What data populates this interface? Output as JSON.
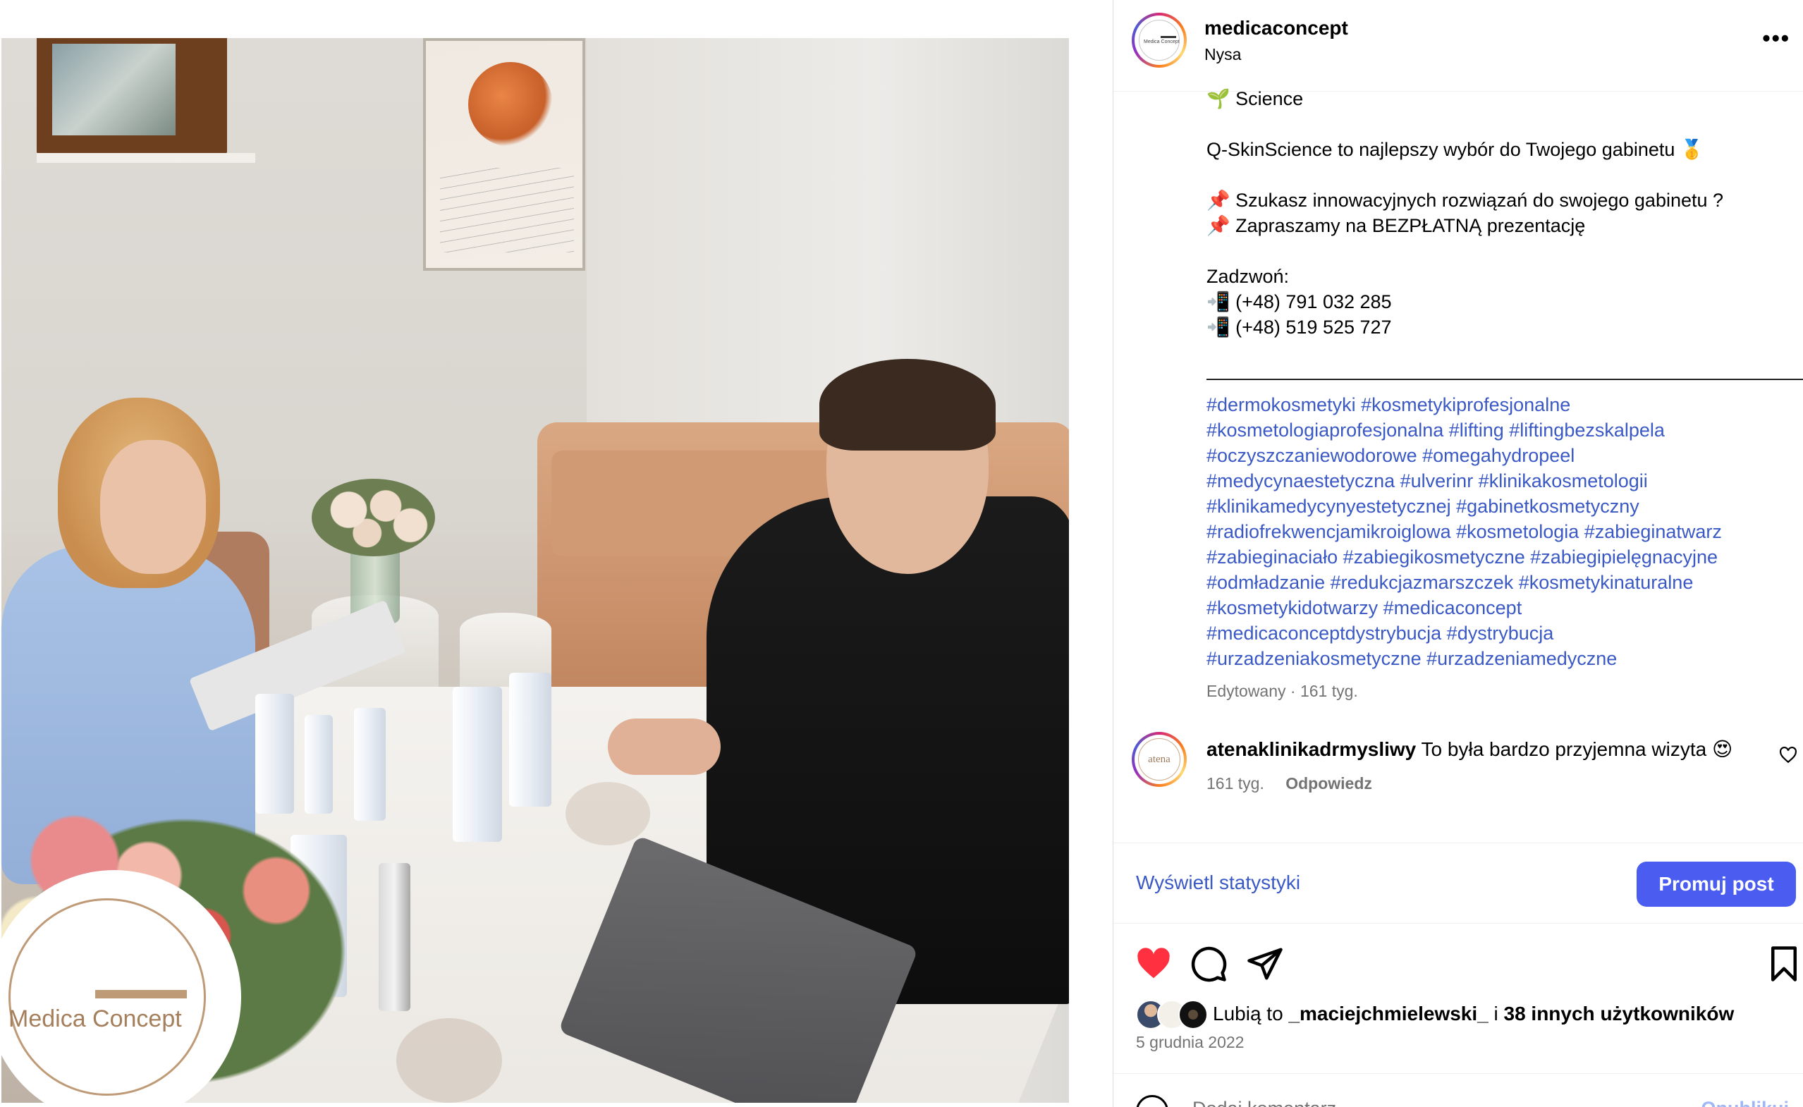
{
  "post": {
    "username": "medicaconcept",
    "location": "Nysa",
    "more_label": "•••",
    "avatar_text": "Medica Concept"
  },
  "photo": {
    "overlay_logo_text": "Medica Concept"
  },
  "caption": {
    "lines": [
      "🌱 Science",
      "",
      "Q-SkinScience to najlepszy wybór do Twojego gabinetu 🥇",
      "",
      "📌 Szukasz innowacyjnych rozwiązań do swojego gabinetu ?",
      "📌 Zapraszamy na BEZPŁATNĄ prezentację",
      "",
      "Zadzwoń:",
      "📲 (+48) 791 032 285",
      "📲 (+48) 519 525 727",
      "",
      "————————————————————————————————————"
    ],
    "hashtag_lines": [
      "#dermokosmetyki #kosmetykiprofesjonalne",
      "#kosmetologiaprofesjonalna #lifting #liftingbezskalpela",
      "#oczyszczaniewodorowe #omegahydropeel",
      "#medycynaestetyczna #ulverinr #klinikakosmetologii",
      "#klinikamedycynyestetycznej #gabinetkosmetyczny",
      "#radiofrekwencjamikroiglowa #kosmetologia #zabieginatwarz",
      "#zabieginaciało #zabiegikosmetyczne #zabiegipielęgnacyjne",
      "#odmładzanie #redukcjazmarszczek #kosmetykinaturalne",
      "#kosmetykidotwarzy #medicaconcept",
      "#medicaconceptdystrybucja #dystrybucja",
      "#urzadzeniakosmetyczne #urzadzeniamedyczne"
    ],
    "meta": "Edytowany · 161 tyg."
  },
  "comment": {
    "username": "atenaklinikadrmysliwy",
    "text": "To była bardzo przyjemna wizyta 😍",
    "age": "161 tyg.",
    "reply_label": "Odpowiedz",
    "avatar_text": "atena"
  },
  "stats": {
    "view_stats_label": "Wyświetl statystyki",
    "promote_label": "Promuj post"
  },
  "likes": {
    "prefix": "Lubią to ",
    "first_user": "_maciejchmielewski_",
    "middle": " i ",
    "others": "38 innych użytkowników",
    "date": "5 grudnia 2022"
  },
  "add_comment": {
    "placeholder": "Dodaj komentarz...",
    "post_label": "Opublikuj"
  },
  "colors": {
    "link_blue": "#3a59c4",
    "button_blue": "#4a5df0",
    "like_red": "#ff3040",
    "meta_gray": "#737373"
  },
  "icons": {
    "like": "heart-filled-icon",
    "comment": "comment-bubble-icon",
    "share": "paper-plane-icon",
    "save": "bookmark-icon",
    "comment_like": "heart-outline-icon",
    "more": "more-dots-icon",
    "emoji": "emoji-icon"
  }
}
